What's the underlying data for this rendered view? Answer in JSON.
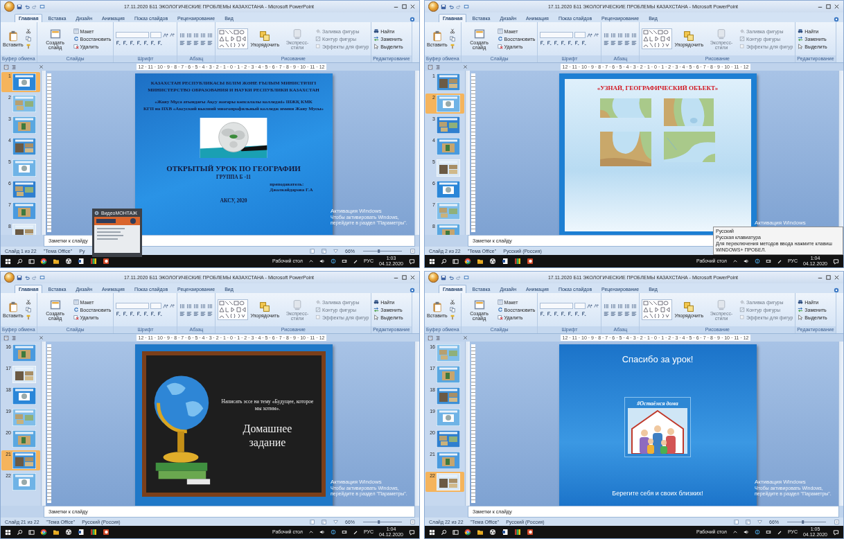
{
  "windows": [
    {
      "title": "17.11.2020 Б11 ЭКОЛОГИЧЕСКИЕ ПРОБЛЕМЫ КАЗАХСТАНА - Microsoft PowerPoint",
      "tabs": [
        {
          "label": "Главная",
          "selected": true
        },
        {
          "label": "Вставка",
          "selected": false
        },
        {
          "label": "Дизайн",
          "selected": false
        },
        {
          "label": "Анимация",
          "selected": false
        },
        {
          "label": "Показ слайдов",
          "selected": false
        },
        {
          "label": "Рецензирование",
          "selected": false
        },
        {
          "label": "Вид",
          "selected": false
        }
      ],
      "ribbon": [
        {
          "kind": "clipboard",
          "label": "Буфер обмена",
          "buttons": [
            {
              "kind": "large",
              "label": "Вставить",
              "disabled": false
            }
          ]
        },
        {
          "kind": "slides",
          "label": "Слайды",
          "buttons": [
            {
              "kind": "large",
              "label": "Создать слайд",
              "disabled": false
            },
            {
              "kind": "small",
              "label": "Макет",
              "disabled": false
            },
            {
              "kind": "small",
              "label": "Восстановить",
              "disabled": false
            },
            {
              "kind": "small",
              "label": "Удалить",
              "disabled": false
            }
          ]
        },
        {
          "kind": "font",
          "label": "Шрифт"
        },
        {
          "kind": "paragraph",
          "label": "Абзац"
        },
        {
          "kind": "drawing",
          "label": "Рисование",
          "buttons": [
            {
              "kind": "large",
              "label": "Упорядочить",
              "disabled": false
            },
            {
              "kind": "large",
              "label": "Экспресс-стили",
              "disabled": true
            },
            {
              "kind": "small",
              "label": "Заливка фигуры",
              "disabled": true
            },
            {
              "kind": "small",
              "label": "Контур фигуры",
              "disabled": true
            },
            {
              "kind": "small",
              "label": "Эффекты для фигур",
              "disabled": true
            }
          ]
        },
        {
          "kind": "editing",
          "label": "Редактирование",
          "buttons": [
            {
              "kind": "small",
              "label": "Найти",
              "disabled": false
            },
            {
              "kind": "small",
              "label": "Заменить",
              "disabled": false
            },
            {
              "kind": "small",
              "label": "Выделить",
              "disabled": false
            }
          ]
        }
      ],
      "ruler": "12 · 11 · 10 · 9 · 8 · 7 · 6 · 5 · 4 · 3 · 2 · 1 · 0 · 1 · 2 · 3 · 4 · 5 · 6 · 7 · 8 · 9 · 10 · 11 · 12",
      "thumbnails": [
        {
          "number": "1",
          "selected": true
        },
        {
          "number": "2",
          "selected": false
        },
        {
          "number": "3",
          "selected": false
        },
        {
          "number": "4",
          "selected": false
        },
        {
          "number": "5",
          "selected": false
        },
        {
          "number": "6",
          "selected": false
        },
        {
          "number": "7",
          "selected": false
        },
        {
          "number": "8",
          "selected": false
        }
      ],
      "slide": {
        "kind": "title",
        "header": [
          "КАЗАХСТАН РЕСПУБЛИКАСЫ БІЛІМ ЖӘНЕ ҒЫЛЫМ МИНИСТРЛІГІ",
          "МИНИСТЕРСТВО ОБРАЗОВАНИЯ И НАУКИ РЕСПУБЛИКИ КАЗАХСТАН"
        ],
        "college": [
          "«Жаяу Мұса атындағы Ақсу жоғары көпсалалы колледжі» ШЖҚ КМК",
          "КГП на ПХВ «Аксуский высший многопрофильный колледж имени Жаяу Мусы»"
        ],
        "heading": "ОТКРЫТЫЙ УРОК ПО ГЕОГРАФИИ",
        "subheading": "ГРУППА Б -11",
        "teacher_label": "преподаватель:",
        "teacher": "Джолкайдарова Г.А",
        "footer": "АКСУ, 2020"
      },
      "activation": {
        "title": "Активация Windows",
        "text": "Чтобы активировать Windows, перейдите в раздел \"Параметры\"."
      },
      "notes": "Заметки к слайду",
      "status": {
        "slide": "Слайд 1 из 22",
        "theme": "\"Тема Office\"",
        "language": "Ру",
        "zoom": "66%",
        "slider": {
          "level": 0.4
        }
      },
      "popup": {
        "kind": "video",
        "title": "ВидеоМОНТАЖ"
      },
      "taskbar": {
        "desktop": "Рабочий стол",
        "lang": "РУС",
        "time": "1:03",
        "date": "04.12.2020"
      }
    },
    {
      "title": "17.11.2020 Б11 ЭКОЛОГИЧЕСКИЕ ПРОБЛЕМЫ КАЗАХСТАНА - Microsoft PowerPoint",
      "tabs": [
        {
          "label": "Главная",
          "selected": true
        },
        {
          "label": "Вставка",
          "selected": false
        },
        {
          "label": "Дизайн",
          "selected": false
        },
        {
          "label": "Анимация",
          "selected": false
        },
        {
          "label": "Показ слайдов",
          "selected": false
        },
        {
          "label": "Рецензирование",
          "selected": false
        },
        {
          "label": "Вид",
          "selected": false
        }
      ],
      "ribbon": [
        {
          "kind": "clipboard",
          "label": "Буфер обмена",
          "buttons": [
            {
              "kind": "large",
              "label": "Вставить",
              "disabled": false
            }
          ]
        },
        {
          "kind": "slides",
          "label": "Слайды",
          "buttons": [
            {
              "kind": "large",
              "label": "Создать слайд",
              "disabled": false
            },
            {
              "kind": "small",
              "label": "Макет",
              "disabled": false
            },
            {
              "kind": "small",
              "label": "Восстановить",
              "disabled": false
            },
            {
              "kind": "small",
              "label": "Удалить",
              "disabled": false
            }
          ]
        },
        {
          "kind": "font",
          "label": "Шрифт"
        },
        {
          "kind": "paragraph",
          "label": "Абзац"
        },
        {
          "kind": "drawing",
          "label": "Рисование",
          "buttons": [
            {
              "kind": "large",
              "label": "Упорядочить",
              "disabled": false
            },
            {
              "kind": "large",
              "label": "Экспресс-стили",
              "disabled": true
            },
            {
              "kind": "small",
              "label": "Заливка фигуры",
              "disabled": true
            },
            {
              "kind": "small",
              "label": "Контур фигуры",
              "disabled": true
            },
            {
              "kind": "small",
              "label": "Эффекты для фигур",
              "disabled": true
            }
          ]
        },
        {
          "kind": "editing",
          "label": "Редактирование",
          "buttons": [
            {
              "kind": "small",
              "label": "Найти",
              "disabled": false
            },
            {
              "kind": "small",
              "label": "Заменить",
              "disabled": false
            },
            {
              "kind": "small",
              "label": "Выделить",
              "disabled": false
            }
          ]
        }
      ],
      "ruler": "12 · 11 · 10 · 9 · 8 · 7 · 6 · 5 · 4 · 3 · 2 · 1 · 0 · 1 · 2 · 3 · 4 · 5 · 6 · 7 · 8 · 9 · 10 · 11 · 12",
      "thumbnails": [
        {
          "number": "1",
          "selected": false
        },
        {
          "number": "2",
          "selected": true
        },
        {
          "number": "3",
          "selected": false
        },
        {
          "number": "4",
          "selected": false
        },
        {
          "number": "5",
          "selected": false
        },
        {
          "number": "6",
          "selected": false
        },
        {
          "number": "7",
          "selected": false
        },
        {
          "number": "8",
          "selected": false
        }
      ],
      "slide": {
        "kind": "quiz",
        "heading": "«УЗНАЙ, ГЕОГРАФИЧЕСКИЙ ОБЪЕКТ»"
      },
      "activation": {
        "title": "Активация Windows"
      },
      "notes": "Заметки к слайду",
      "status": {
        "slide": "Слайд 2 из 22",
        "theme": "\"Тема Office\"",
        "language": "Русский (Россия)"
      },
      "popup": {
        "kind": "language",
        "lines": [
          "Русский",
          "Русская клавиатура",
          "Для переключения методов ввода нажмите клавиш",
          "WINDOWS+ ПРОБЕЛ."
        ]
      },
      "taskbar": {
        "desktop": "Рабочий стол",
        "lang": "РУС",
        "time": "1:04",
        "date": "04.12.2020"
      }
    },
    {
      "title": "17.11.2020 Б11 ЭКОЛОГИЧЕСКИЕ ПРОБЛЕМЫ КАЗАХСТАНА - Microsoft PowerPoint",
      "tabs": [
        {
          "label": "Главная",
          "selected": true
        },
        {
          "label": "Вставка",
          "selected": false
        },
        {
          "label": "Дизайн",
          "selected": false
        },
        {
          "label": "Анимация",
          "selected": false
        },
        {
          "label": "Показ слайдов",
          "selected": false
        },
        {
          "label": "Рецензирование",
          "selected": false
        },
        {
          "label": "Вид",
          "selected": false
        }
      ],
      "ribbon": [
        {
          "kind": "clipboard",
          "label": "Буфер обмена",
          "buttons": [
            {
              "kind": "large",
              "label": "Вставить",
              "disabled": false
            }
          ]
        },
        {
          "kind": "slides",
          "label": "Слайды",
          "buttons": [
            {
              "kind": "large",
              "label": "Создать слайд",
              "disabled": false
            },
            {
              "kind": "small",
              "label": "Макет",
              "disabled": false
            },
            {
              "kind": "small",
              "label": "Восстановить",
              "disabled": false
            },
            {
              "kind": "small",
              "label": "Удалить",
              "disabled": false
            }
          ]
        },
        {
          "kind": "font",
          "label": "Шрифт"
        },
        {
          "kind": "paragraph",
          "label": "Абзац"
        },
        {
          "kind": "drawing",
          "label": "Рисование",
          "buttons": [
            {
              "kind": "large",
              "label": "Упорядочить",
              "disabled": false
            },
            {
              "kind": "large",
              "label": "Экспресс-стили",
              "disabled": true
            },
            {
              "kind": "small",
              "label": "Заливка фигуры",
              "disabled": true
            },
            {
              "kind": "small",
              "label": "Контур фигуры",
              "disabled": true
            },
            {
              "kind": "small",
              "label": "Эффекты для фигур",
              "disabled": true
            }
          ]
        },
        {
          "kind": "editing",
          "label": "Редактирование",
          "buttons": [
            {
              "kind": "small",
              "label": "Найти",
              "disabled": false
            },
            {
              "kind": "small",
              "label": "Заменить",
              "disabled": false
            },
            {
              "kind": "small",
              "label": "Выделить",
              "disabled": false
            }
          ]
        }
      ],
      "ruler": "12 · 11 · 10 · 9 · 8 · 7 · 6 · 5 · 4 · 3 · 2 · 1 · 0 · 1 · 2 · 3 · 4 · 5 · 6 · 7 · 8 · 9 · 10 · 11 · 12",
      "thumbnails": [
        {
          "number": "16",
          "selected": false
        },
        {
          "number": "17",
          "selected": false
        },
        {
          "number": "18",
          "selected": false
        },
        {
          "number": "19",
          "selected": false
        },
        {
          "number": "20",
          "selected": false
        },
        {
          "number": "21",
          "selected": true
        },
        {
          "number": "22",
          "selected": false
        }
      ],
      "slide": {
        "kind": "homework",
        "task": "Написать эссе на тему «Будущее, которое мы хотим».",
        "heading": "Домашнее задание"
      },
      "activation": {
        "title": "Активация Windows",
        "text": "Чтобы активировать Windows, перейдите в раздел \"Параметры\"."
      },
      "notes": "Заметки к слайду",
      "status": {
        "slide": "Слайд 21 из 22",
        "theme": "\"Тема Office\"",
        "language": "Русский (Россия)",
        "zoom": "66%",
        "slider": {
          "level": 0.4
        }
      },
      "taskbar": {
        "desktop": "Рабочий стол",
        "lang": "РУС",
        "time": "1:04",
        "date": "04.12.2020"
      }
    },
    {
      "title": "17.11.2020 Б11 ЭКОЛОГИЧЕСКИЕ ПРОБЛЕМЫ КАЗАХСТАНА - Microsoft PowerPoint",
      "tabs": [
        {
          "label": "Главная",
          "selected": true
        },
        {
          "label": "Вставка",
          "selected": false
        },
        {
          "label": "Дизайн",
          "selected": false
        },
        {
          "label": "Анимация",
          "selected": false
        },
        {
          "label": "Показ слайдов",
          "selected": false
        },
        {
          "label": "Рецензирование",
          "selected": false
        },
        {
          "label": "Вид",
          "selected": false
        }
      ],
      "ribbon": [
        {
          "kind": "clipboard",
          "label": "Буфер обмена",
          "buttons": [
            {
              "kind": "large",
              "label": "Вставить",
              "disabled": false
            }
          ]
        },
        {
          "kind": "slides",
          "label": "Слайды",
          "buttons": [
            {
              "kind": "large",
              "label": "Создать слайд",
              "disabled": false
            },
            {
              "kind": "small",
              "label": "Макет",
              "disabled": false
            },
            {
              "kind": "small",
              "label": "Восстановить",
              "disabled": false
            },
            {
              "kind": "small",
              "label": "Удалить",
              "disabled": false
            }
          ]
        },
        {
          "kind": "font",
          "label": "Шрифт"
        },
        {
          "kind": "paragraph",
          "label": "Абзац"
        },
        {
          "kind": "drawing",
          "label": "Рисование",
          "buttons": [
            {
              "kind": "large",
              "label": "Упорядочить",
              "disabled": false
            },
            {
              "kind": "large",
              "label": "Экспресс-стили",
              "disabled": true
            },
            {
              "kind": "small",
              "label": "Заливка фигуры",
              "disabled": true
            },
            {
              "kind": "small",
              "label": "Контур фигуры",
              "disabled": true
            },
            {
              "kind": "small",
              "label": "Эффекты для фигур",
              "disabled": true
            }
          ]
        },
        {
          "kind": "editing",
          "label": "Редактирование",
          "buttons": [
            {
              "kind": "small",
              "label": "Найти",
              "disabled": false
            },
            {
              "kind": "small",
              "label": "Заменить",
              "disabled": false
            },
            {
              "kind": "small",
              "label": "Выделить",
              "disabled": false
            }
          ]
        }
      ],
      "ruler": "12 · 11 · 10 · 9 · 8 · 7 · 6 · 5 · 4 · 3 · 2 · 1 · 0 · 1 · 2 · 3 · 4 · 5 · 6 · 7 · 8 · 9 · 10 · 11 · 12",
      "thumbnails": [
        {
          "number": "16",
          "selected": false
        },
        {
          "number": "17",
          "selected": false
        },
        {
          "number": "18",
          "selected": false
        },
        {
          "number": "19",
          "selected": false
        },
        {
          "number": "20",
          "selected": false
        },
        {
          "number": "21",
          "selected": false
        },
        {
          "number": "22",
          "selected": true
        }
      ],
      "slide": {
        "kind": "thanks",
        "heading": "Спасибо за урок!",
        "hashtag": "#Остаёмся дома",
        "footer": "Берегите себя и своих близких!"
      },
      "activation": {
        "title": "Активация Windows",
        "text": "Чтобы активировать Windows, перейдите в раздел \"Параметры\"."
      },
      "notes": "Заметки к слайду",
      "status": {
        "slide": "Слайд 22 из 22",
        "theme": "\"Тема Office\"",
        "language": "Русский (Россия)",
        "zoom": "66%",
        "slider": {
          "level": 0.4
        }
      },
      "taskbar": {
        "desktop": "Рабочий стол",
        "lang": "РУС",
        "time": "1:05",
        "date": "04.12.2020"
      }
    }
  ]
}
